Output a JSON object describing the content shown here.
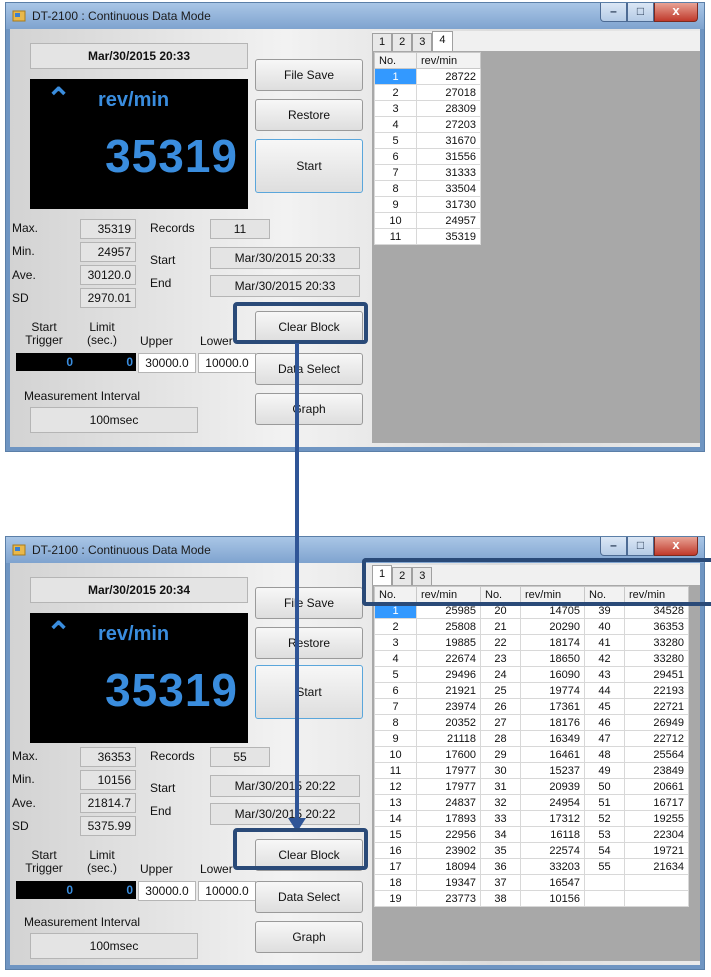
{
  "window_title": "DT-2100 : Continuous Data Mode",
  "window_controls": {
    "minimize": "–",
    "maximize": "□",
    "close": "x"
  },
  "labels": {
    "max": "Max.",
    "min": "Min.",
    "ave": "Ave.",
    "sd": "SD",
    "records": "Records",
    "start": "Start",
    "end": "End",
    "start_trigger_1": "Start",
    "start_trigger_2": "Trigger",
    "limit_1": "Limit",
    "limit_2": "(sec.)",
    "upper": "Upper",
    "lower": "Lower",
    "measurement_interval": "Measurement Interval"
  },
  "buttons": {
    "file_save": "File Save",
    "restore": "Restore",
    "start": "Start",
    "clear_block": "Clear Block",
    "data_select": "Data Select",
    "graph": "Graph"
  },
  "top": {
    "datetime": "Mar/30/2015 20:33",
    "unit": "rev/min",
    "display_value": "35319",
    "max": "35319",
    "min": "24957",
    "ave": "30120.0",
    "sd": "2970.01",
    "records": "11",
    "start_time": "Mar/30/2015 20:33",
    "end_time": "Mar/30/2015 20:33",
    "trigger": "0",
    "limit": "0",
    "upper": "30000.0",
    "lower": "10000.0",
    "interval": "100msec",
    "tabs": [
      "1",
      "2",
      "3",
      "4"
    ],
    "columns": [
      "No.",
      "rev/min"
    ],
    "rows": [
      [
        "1",
        "28722"
      ],
      [
        "2",
        "27018"
      ],
      [
        "3",
        "28309"
      ],
      [
        "4",
        "27203"
      ],
      [
        "5",
        "31670"
      ],
      [
        "6",
        "31556"
      ],
      [
        "7",
        "31333"
      ],
      [
        "8",
        "33504"
      ],
      [
        "9",
        "31730"
      ],
      [
        "10",
        "24957"
      ],
      [
        "11",
        "35319"
      ]
    ]
  },
  "bottom": {
    "datetime": "Mar/30/2015 20:34",
    "unit": "rev/min",
    "display_value": "35319",
    "max": "36353",
    "min": "10156",
    "ave": "21814.7",
    "sd": "5375.99",
    "records": "55",
    "start_time": "Mar/30/2015 20:22",
    "end_time": "Mar/30/2015 20:22",
    "trigger": "0",
    "limit": "0",
    "upper": "30000.0",
    "lower": "10000.0",
    "interval": "100msec",
    "tabs": [
      "1",
      "2",
      "3"
    ],
    "columns": [
      "No.",
      "rev/min",
      "No.",
      "rev/min",
      "No.",
      "rev/min"
    ],
    "rows": [
      [
        "1",
        "25985",
        "20",
        "14705",
        "39",
        "34528"
      ],
      [
        "2",
        "25808",
        "21",
        "20290",
        "40",
        "36353"
      ],
      [
        "3",
        "19885",
        "22",
        "18174",
        "41",
        "33280"
      ],
      [
        "4",
        "22674",
        "23",
        "18650",
        "42",
        "33280"
      ],
      [
        "5",
        "29496",
        "24",
        "16090",
        "43",
        "29451"
      ],
      [
        "6",
        "21921",
        "25",
        "19774",
        "44",
        "22193"
      ],
      [
        "7",
        "23974",
        "26",
        "17361",
        "45",
        "22721"
      ],
      [
        "8",
        "20352",
        "27",
        "18176",
        "46",
        "26949"
      ],
      [
        "9",
        "21118",
        "28",
        "16349",
        "47",
        "22712"
      ],
      [
        "10",
        "17600",
        "29",
        "16461",
        "48",
        "25564"
      ],
      [
        "11",
        "17977",
        "30",
        "15237",
        "49",
        "23849"
      ],
      [
        "12",
        "17977",
        "31",
        "20939",
        "50",
        "20661"
      ],
      [
        "13",
        "24837",
        "32",
        "24954",
        "51",
        "16717"
      ],
      [
        "14",
        "17893",
        "33",
        "17312",
        "52",
        "19255"
      ],
      [
        "15",
        "22956",
        "34",
        "16118",
        "53",
        "22304"
      ],
      [
        "16",
        "23902",
        "35",
        "22574",
        "54",
        "19721"
      ],
      [
        "17",
        "18094",
        "36",
        "33203",
        "55",
        "21634"
      ],
      [
        "18",
        "19347",
        "37",
        "16547",
        "",
        ""
      ],
      [
        "19",
        "23773",
        "38",
        "10156",
        "",
        ""
      ]
    ]
  }
}
